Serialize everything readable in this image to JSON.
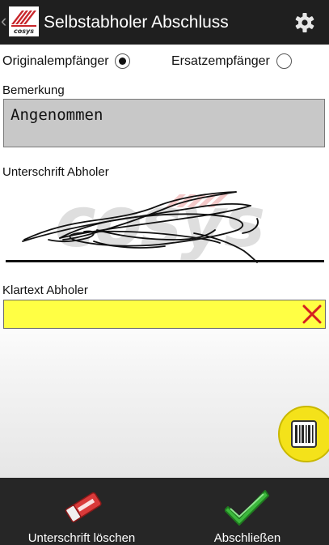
{
  "app_bar": {
    "title": "Selbstabholer Abschluss",
    "back_icon": "chevron-left-icon",
    "logo_icon": "app-logo-icon",
    "settings_icon": "gear-icon"
  },
  "recipient": {
    "original_label": "Originalempfänger",
    "original_selected": true,
    "substitute_label": "Ersatzempfänger",
    "substitute_selected": false
  },
  "remark": {
    "label": "Bemerkung",
    "value": "Angenommen"
  },
  "signature": {
    "label": "Unterschrift Abholer"
  },
  "clear_text": {
    "label": "Klartext Abholer",
    "value": "",
    "clear_icon": "close-icon"
  },
  "fab": {
    "icon": "barcode-icon"
  },
  "bottom_bar": {
    "clear_signature_label": "Unterschrift löschen",
    "clear_signature_icon": "eraser-icon",
    "finish_label": "Abschließen",
    "finish_icon": "checkmark-icon"
  },
  "colors": {
    "app_bar": "#1f1f1f",
    "bottom_bar": "#262626",
    "remark_box": "#c8c8c8",
    "clear_text_box": "#ffff44",
    "fab": "#f4e21a",
    "accent_red": "#d42020",
    "accent_green": "#3cb83c"
  }
}
